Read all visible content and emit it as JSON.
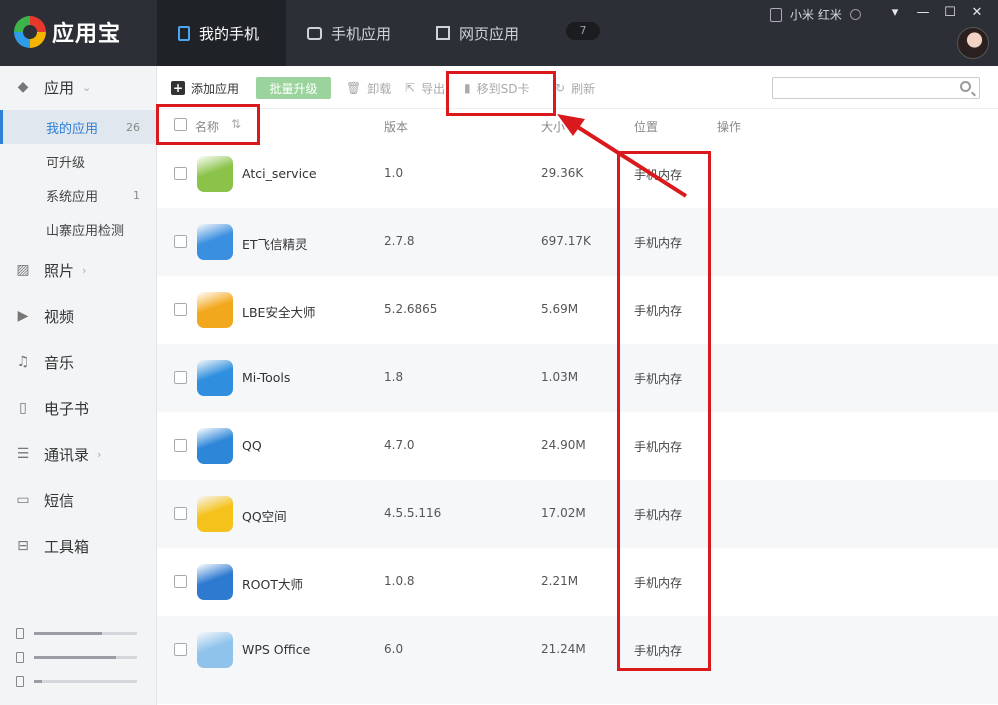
{
  "app": {
    "name": "应用宝"
  },
  "nav": {
    "tabs": [
      {
        "label": "我的手机"
      },
      {
        "label": "手机应用"
      },
      {
        "label": "网页应用"
      }
    ],
    "download_count": "7"
  },
  "device": {
    "name": "小米 红米"
  },
  "window": {
    "minimize": "▾",
    "restore": "—",
    "maximize": "☐",
    "close": "✕"
  },
  "sidebar": {
    "apps_label": "应用",
    "sub_items": [
      {
        "label": "我的应用",
        "count": "26"
      },
      {
        "label": "可升级",
        "count": ""
      },
      {
        "label": "系统应用",
        "count": "1"
      },
      {
        "label": "山寨应用检测",
        "count": ""
      }
    ],
    "sections": [
      {
        "label": "照片",
        "icon": "photo-icon"
      },
      {
        "label": "视频",
        "icon": "video-icon"
      },
      {
        "label": "音乐",
        "icon": "music-icon"
      },
      {
        "label": "电子书",
        "icon": "book-icon"
      },
      {
        "label": "通讯录",
        "icon": "contacts-icon"
      },
      {
        "label": "短信",
        "icon": "sms-icon"
      },
      {
        "label": "工具箱",
        "icon": "toolbox-icon"
      }
    ],
    "storage": [
      {
        "used": 0.66
      },
      {
        "used": 0.8
      },
      {
        "used": 0.08
      }
    ]
  },
  "toolbar": {
    "add_label": "添加应用",
    "upgrade_label": "批量升级",
    "uninstall_label": "卸载",
    "export_label": "导出",
    "move_label": "移到SD卡",
    "refresh_label": "刷新",
    "search_placeholder": ""
  },
  "table": {
    "headers": {
      "name": "名称",
      "version": "版本",
      "size": "大小",
      "location": "位置",
      "actions": "操作"
    },
    "rows": [
      {
        "name": "Atci_service",
        "version": "1.0",
        "size": "29.36K",
        "location": "手机内存",
        "icon": "android-icon",
        "color": "#8bc34a"
      },
      {
        "name": "ET飞信精灵",
        "version": "2.7.8",
        "size": "697.17K",
        "location": "手机内存",
        "icon": "fetion-icon",
        "color": "#3b8fe0"
      },
      {
        "name": "LBE安全大师",
        "version": "5.2.6865",
        "size": "5.69M",
        "location": "手机内存",
        "icon": "shield-icon",
        "color": "#f2a81c"
      },
      {
        "name": "Mi-Tools",
        "version": "1.8",
        "size": "1.03M",
        "location": "手机内存",
        "icon": "tools-icon",
        "color": "#2f8fde"
      },
      {
        "name": "QQ",
        "version": "4.7.0",
        "size": "24.90M",
        "location": "手机内存",
        "icon": "qq-penguin-icon",
        "color": "#2d86d8"
      },
      {
        "name": "QQ空间",
        "version": "4.5.5.116",
        "size": "17.02M",
        "location": "手机内存",
        "icon": "qzone-star-icon",
        "color": "#f5c21b"
      },
      {
        "name": "ROOT大师",
        "version": "1.0.8",
        "size": "2.21M",
        "location": "手机内存",
        "icon": "anchor-icon",
        "color": "#2e7ad1"
      },
      {
        "name": "WPS Office",
        "version": "6.0",
        "size": "21.24M",
        "location": "手机内存",
        "icon": "wps-icon",
        "color": "#8fc3ec"
      }
    ]
  },
  "annotation_color": "#d9191b"
}
